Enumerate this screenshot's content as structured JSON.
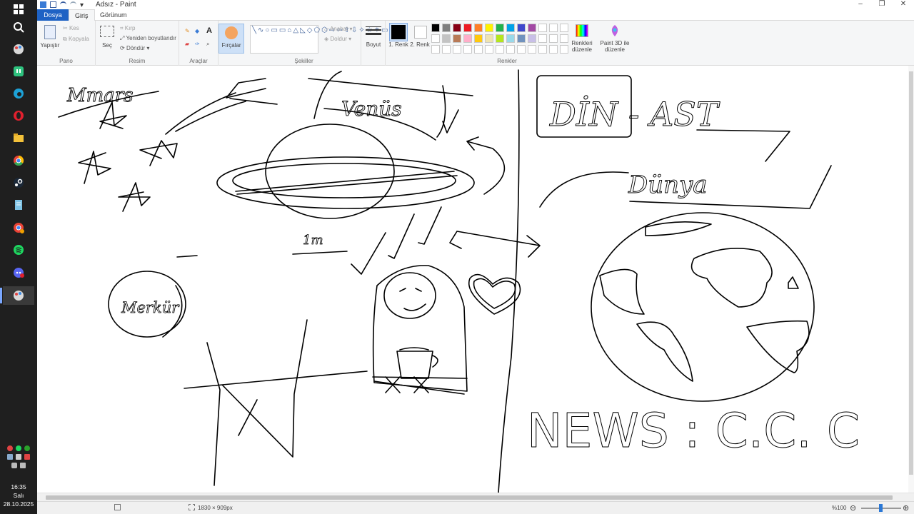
{
  "window": {
    "title": "Adsız - Paint"
  },
  "tabs": {
    "file": "Dosya",
    "home": "Giriş",
    "view": "Görünum"
  },
  "ribbon": {
    "clipboard": {
      "paste": "Yapıştır",
      "cut": "Kes",
      "copy": "Kopyala",
      "group": "Pano"
    },
    "image": {
      "select": "Seç",
      "crop": "Kırp",
      "resize": "Yeniden boyutlandır",
      "rotate": "Döndür",
      "group": "Resim"
    },
    "tools": {
      "group": "Araçlar"
    },
    "brushes": {
      "label": "Fırçalar"
    },
    "shapes": {
      "outline": "Anahat",
      "fill": "Doldur",
      "group": "Şekiller"
    },
    "size": {
      "label": "Boyut"
    },
    "colors": {
      "color1": "1. Renk",
      "color2": "2. Renk",
      "edit": "Renkleri düzenle",
      "paint3d": "Paint 3D ile düzenle",
      "group": "Renkler",
      "palette_row1": [
        "#000000",
        "#7f7f7f",
        "#880015",
        "#ed1c24",
        "#ff7f27",
        "#fff200",
        "#22b14c",
        "#00a2e8",
        "#3f48cc",
        "#a349a4"
      ],
      "palette_row2": [
        "#ffffff",
        "#c3c3c3",
        "#b97a57",
        "#ffaec9",
        "#ffc90e",
        "#efe4b0",
        "#b5e61d",
        "#99d9ea",
        "#7092be",
        "#c8bfe7"
      ]
    }
  },
  "drawing": {
    "mars": "Mmars",
    "venus": "Venüs",
    "merkur": "Merkür",
    "one_m": "1m",
    "din_ast": "DİN - AST",
    "dunya": "Dünya",
    "news": "NEWS : C.C. C"
  },
  "status": {
    "dimensions": "1830 × 909px",
    "zoom": "%100"
  },
  "taskbar": {
    "time": "16:35",
    "day": "Salı",
    "date": "28.10.2025"
  }
}
